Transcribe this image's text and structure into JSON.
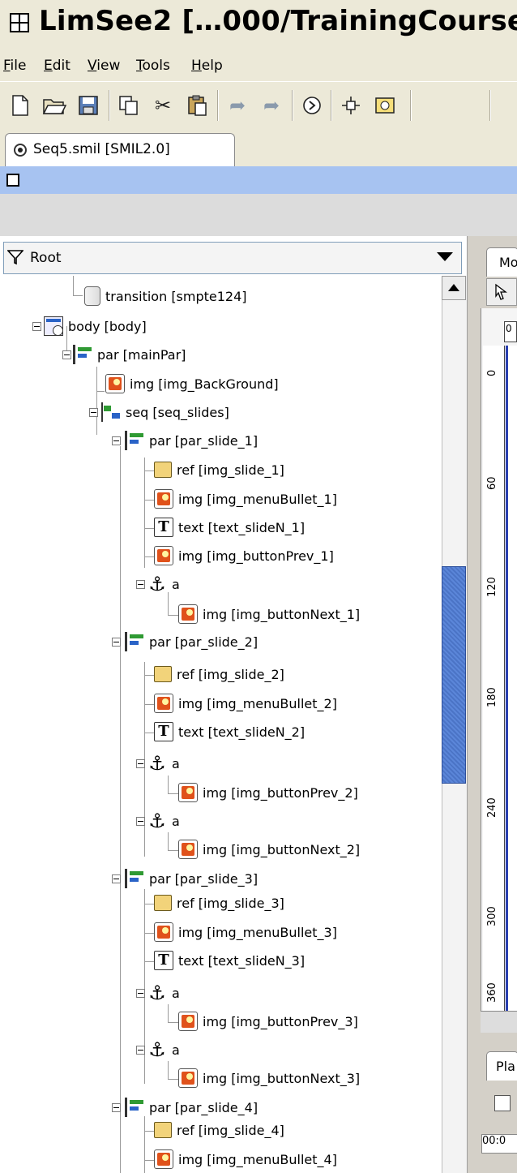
{
  "window": {
    "title": "LimSee2 […000/TrainingCourse."
  },
  "menu": {
    "items": [
      {
        "label": "File",
        "key": "F",
        "rest": "ile"
      },
      {
        "label": "Edit",
        "key": "E",
        "rest": "dit"
      },
      {
        "label": "View",
        "key": "V",
        "rest": "iew"
      },
      {
        "label": "Tools",
        "key": "T",
        "rest": "ools"
      },
      {
        "label": "Help",
        "key": "H",
        "rest": "elp"
      }
    ]
  },
  "toolbar": {
    "items": [
      "new-icon",
      "open-icon",
      "save-icon",
      "copy-icon",
      "cut-icon",
      "paste-icon",
      "undo-icon",
      "redo-icon",
      "play-icon",
      "move-icon",
      "preview-icon"
    ]
  },
  "tab": {
    "label": "Seq5.smil [SMIL2.0]"
  },
  "filter": {
    "label": "Root"
  },
  "tree": {
    "nodes": [
      {
        "label": "transition [smpte124]",
        "icon": "transition"
      },
      {
        "label": "body [body]",
        "icon": "body"
      },
      {
        "label": "par [mainPar]",
        "icon": "par"
      },
      {
        "label": "img [img_BackGround]",
        "icon": "img"
      },
      {
        "label": "seq [seq_slides]",
        "icon": "seq"
      },
      {
        "label": "par [par_slide_1]",
        "icon": "par"
      },
      {
        "label": "ref [img_slide_1]",
        "icon": "ref"
      },
      {
        "label": "img [img_menuBullet_1]",
        "icon": "img"
      },
      {
        "label": "text [text_slideN_1]",
        "icon": "text"
      },
      {
        "label": "img [img_buttonPrev_1]",
        "icon": "img"
      },
      {
        "label": "a",
        "icon": "anchor"
      },
      {
        "label": "img [img_buttonNext_1]",
        "icon": "img"
      },
      {
        "label": "par [par_slide_2]",
        "icon": "par"
      },
      {
        "label": "ref [img_slide_2]",
        "icon": "ref"
      },
      {
        "label": "img [img_menuBullet_2]",
        "icon": "img"
      },
      {
        "label": "text [text_slideN_2]",
        "icon": "text"
      },
      {
        "label": "a",
        "icon": "anchor"
      },
      {
        "label": "img [img_buttonPrev_2]",
        "icon": "img"
      },
      {
        "label": "a",
        "icon": "anchor"
      },
      {
        "label": "img [img_buttonNext_2]",
        "icon": "img"
      },
      {
        "label": "par [par_slide_3]",
        "icon": "par"
      },
      {
        "label": "ref [img_slide_3]",
        "icon": "ref"
      },
      {
        "label": "img [img_menuBullet_3]",
        "icon": "img"
      },
      {
        "label": "text [text_slideN_3]",
        "icon": "text"
      },
      {
        "label": "a",
        "icon": "anchor"
      },
      {
        "label": "img [img_buttonPrev_3]",
        "icon": "img"
      },
      {
        "label": "a",
        "icon": "anchor"
      },
      {
        "label": "img [img_buttonNext_3]",
        "icon": "img"
      },
      {
        "label": "par [par_slide_4]",
        "icon": "par"
      },
      {
        "label": "ref [img_slide_4]",
        "icon": "ref"
      },
      {
        "label": "img [img_menuBullet_4]",
        "icon": "img"
      }
    ]
  },
  "right_panel": {
    "tab1_label": "Mo",
    "tab2_label": "Pla",
    "ruler_top": "0",
    "ruler_ticks": [
      "0",
      "60",
      "120",
      "180",
      "240",
      "300",
      "360"
    ],
    "time_label": "00:0"
  }
}
